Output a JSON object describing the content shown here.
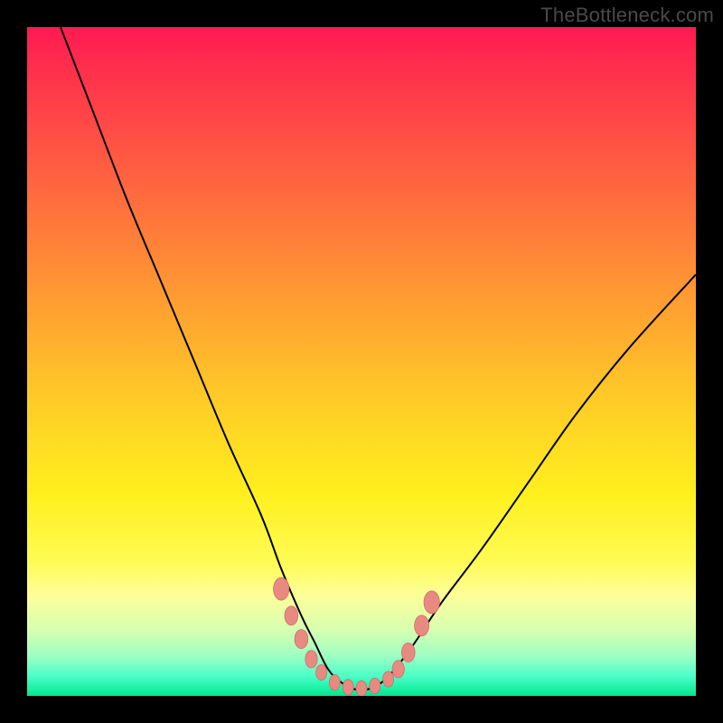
{
  "watermark": "TheBottleneck.com",
  "colors": {
    "frame": "#000000",
    "curve": "#000000",
    "marker_fill": "#e88a82",
    "marker_stroke": "#cc6a62",
    "gradient_top": "#ff1a52",
    "gradient_bottom": "#00e890"
  },
  "chart_data": {
    "type": "line",
    "title": "",
    "xlabel": "",
    "ylabel": "",
    "xlim": [
      0,
      100
    ],
    "ylim": [
      0,
      100
    ],
    "grid": false,
    "legend": false,
    "annotations": [
      "TheBottleneck.com"
    ],
    "series": [
      {
        "name": "bottleneck-curve",
        "x": [
          5,
          10,
          15,
          20,
          25,
          30,
          35,
          38,
          41,
          43,
          45,
          47,
          49,
          51,
          53,
          55,
          58,
          62,
          68,
          75,
          82,
          90,
          100
        ],
        "values": [
          100,
          87,
          74,
          62,
          50,
          38,
          27,
          19,
          12,
          8,
          4,
          2,
          1,
          1,
          2,
          4,
          8,
          14,
          22,
          32,
          42,
          52,
          63
        ]
      }
    ],
    "markers": [
      {
        "x": 38.0,
        "y": 16.0,
        "r": 1.3
      },
      {
        "x": 39.5,
        "y": 12.0,
        "r": 1.1
      },
      {
        "x": 41.0,
        "y": 8.5,
        "r": 1.1
      },
      {
        "x": 42.5,
        "y": 5.5,
        "r": 1.0
      },
      {
        "x": 44.0,
        "y": 3.5,
        "r": 0.9
      },
      {
        "x": 46.0,
        "y": 2.0,
        "r": 0.9
      },
      {
        "x": 48.0,
        "y": 1.3,
        "r": 0.9
      },
      {
        "x": 50.0,
        "y": 1.1,
        "r": 0.9
      },
      {
        "x": 52.0,
        "y": 1.5,
        "r": 0.9
      },
      {
        "x": 54.0,
        "y": 2.5,
        "r": 0.9
      },
      {
        "x": 55.5,
        "y": 4.0,
        "r": 1.0
      },
      {
        "x": 57.0,
        "y": 6.5,
        "r": 1.1
      },
      {
        "x": 59.0,
        "y": 10.5,
        "r": 1.2
      },
      {
        "x": 60.5,
        "y": 14.0,
        "r": 1.3
      }
    ]
  }
}
